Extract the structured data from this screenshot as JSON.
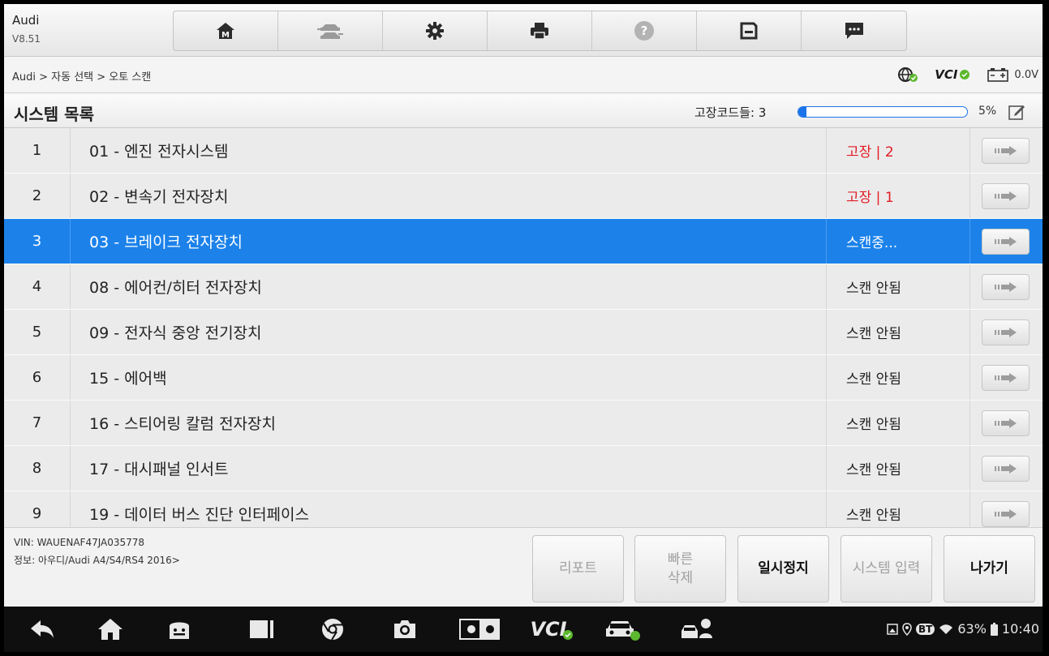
{
  "app": {
    "title": "Audi",
    "version": "V8.51"
  },
  "toolbar": {
    "items": [
      {
        "name": "home",
        "icon": "home-icon"
      },
      {
        "name": "vehicle-swap",
        "icon": "car-swap-icon"
      },
      {
        "name": "settings",
        "icon": "gear-icon"
      },
      {
        "name": "print",
        "icon": "printer-icon"
      },
      {
        "name": "help",
        "icon": "help-icon"
      },
      {
        "name": "save",
        "icon": "save-icon"
      },
      {
        "name": "data-logging",
        "icon": "message-icon"
      }
    ]
  },
  "breadcrumb": "Audi > 자동 선택 > 오토 스캔",
  "status": {
    "vci_label": "VCI",
    "voltage": "0.0V"
  },
  "list": {
    "title": "시스템 목록",
    "fault_codes_label": "고장코드들: 3",
    "progress_percent": 5,
    "progress_text": "5%"
  },
  "rows": [
    {
      "index": "1",
      "name": "01 - 엔진 전자시스템",
      "status": "고장 | 2",
      "fault": true,
      "selected": false
    },
    {
      "index": "2",
      "name": "02 - 변속기 전자장치",
      "status": "고장 | 1",
      "fault": true,
      "selected": false
    },
    {
      "index": "3",
      "name": "03 - 브레이크 전자장치",
      "status": "스캔중...",
      "fault": false,
      "selected": true
    },
    {
      "index": "4",
      "name": "08 - 에어컨/히터 전자장치",
      "status": "스캔 안됨",
      "fault": false,
      "selected": false
    },
    {
      "index": "5",
      "name": "09 - 전자식 중앙 전기장치",
      "status": "스캔 안됨",
      "fault": false,
      "selected": false
    },
    {
      "index": "6",
      "name": "15 - 에어백",
      "status": "스캔 안됨",
      "fault": false,
      "selected": false
    },
    {
      "index": "7",
      "name": "16 - 스티어링 칼럼 전자장치",
      "status": "스캔 안됨",
      "fault": false,
      "selected": false
    },
    {
      "index": "8",
      "name": "17 - 대시패널 인서트",
      "status": "스캔 안됨",
      "fault": false,
      "selected": false
    },
    {
      "index": "9",
      "name": "19 - 데이터 버스 진단 인터페이스",
      "status": "스캔 안됨",
      "fault": false,
      "selected": false
    }
  ],
  "footer": {
    "vin": "VIN: WAUENAF47JA035778",
    "info": "정보: 아우디/Audi A4/S4/RS4 2016>",
    "buttons": {
      "report": "리포트",
      "quick_erase_1": "빠른",
      "quick_erase_2": "삭제",
      "pause": "일시정지",
      "system_input": "시스템 입력",
      "exit": "나가기"
    }
  },
  "navbar": {
    "vci_label": "VCI",
    "battery": "63%",
    "time": "10:40",
    "bt": "BT"
  },
  "colors": {
    "selected_row": "#1c82ea",
    "fault_text": "#e21b23",
    "progress": "#1a73e8",
    "connected_green": "#5cb82e"
  }
}
